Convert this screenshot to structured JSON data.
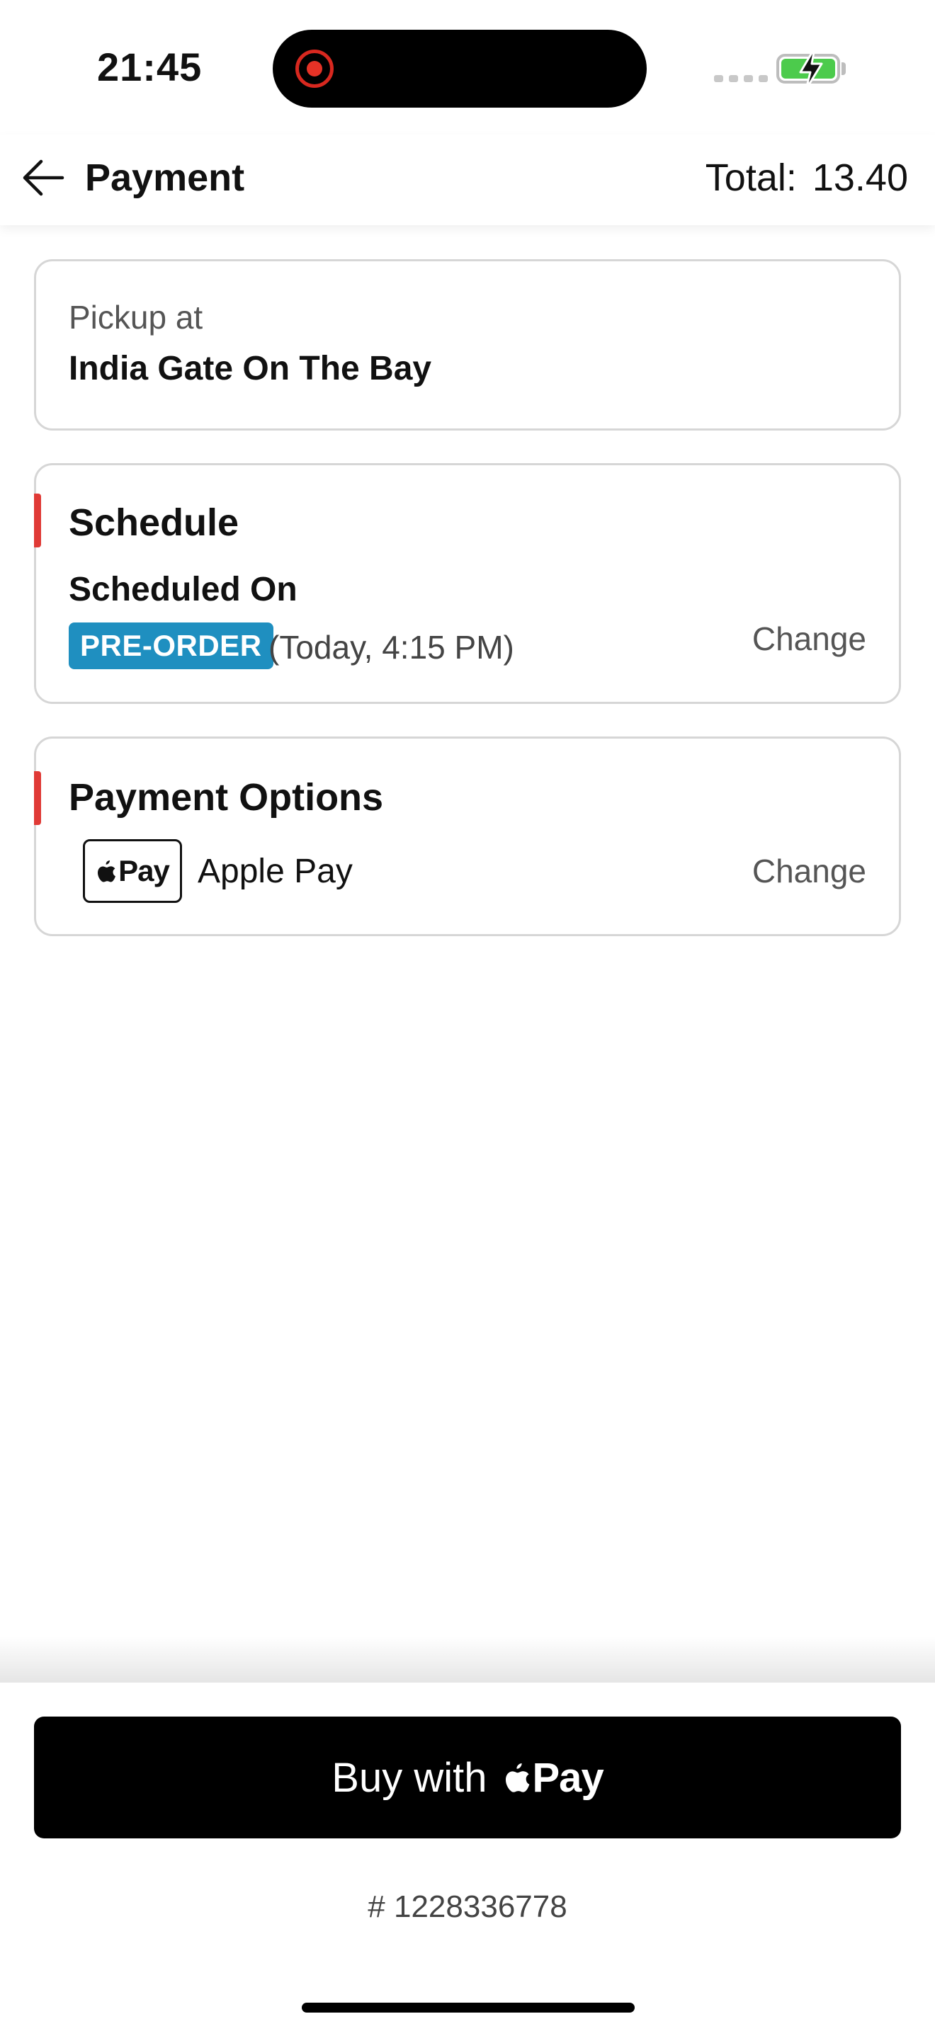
{
  "status_bar": {
    "time": "21:45"
  },
  "header": {
    "title": "Payment",
    "total_label": "Total:",
    "total_amount": "13.40"
  },
  "pickup": {
    "label": "Pickup at",
    "location": "India Gate On The Bay"
  },
  "schedule": {
    "title": "Schedule",
    "scheduled_on_label": "Scheduled On",
    "badge": "PRE-ORDER",
    "time": "(Today, 4:15 PM)",
    "change_label": "Change"
  },
  "payment": {
    "title": "Payment Options",
    "logo_text": "Pay",
    "method": "Apple Pay",
    "change_label": "Change"
  },
  "footer": {
    "buy_label": "Buy with",
    "buy_pay_text": "Pay",
    "order_number": "# 1228336778"
  },
  "colors": {
    "accent_red": "#e03a36",
    "badge_blue": "#1f8fc0",
    "battery_green": "#4ccb4c",
    "button_black": "#000000"
  },
  "icons": {
    "back": "arrow-left-icon",
    "recording": "recording-indicator-icon",
    "battery": "battery-charging-icon",
    "apple": "apple-logo-icon"
  }
}
